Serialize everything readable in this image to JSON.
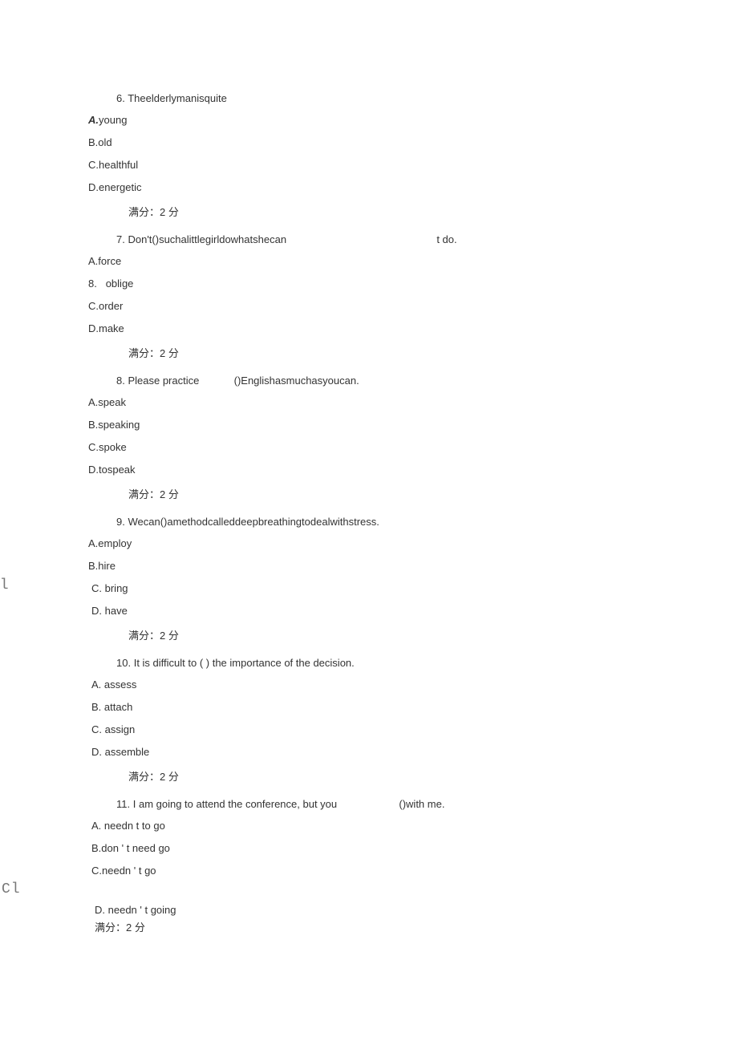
{
  "questions": [
    {
      "num": "6.",
      "text": "Theelderlymanisquite",
      "trail": "",
      "opts": {
        "A": "young",
        "B": "old",
        "C": "healthful",
        "D": "energetic"
      },
      "score": "满分：2 分",
      "bold_a": true
    },
    {
      "num": "7.",
      "text": "Don't()suchalittlegirldowhatshecan",
      "trail": "t do.",
      "opts": {
        "A": "force",
        "B_label": "8.",
        "B": "oblige",
        "C": "order",
        "D": "make"
      },
      "score": "满分：2 分"
    },
    {
      "num": "8.",
      "text_a": "Please practice",
      "text_b": "()Englishasmuchasyoucan.",
      "opts": {
        "A": "speak",
        "B": "speaking",
        "C": "spoke",
        "D": "tospeak"
      },
      "score": "满分：2 分"
    },
    {
      "num": "9.",
      "text": "Wecan()amethodcalleddeepbreathingtodealwithstress.",
      "opts": {
        "A": "employ",
        "B": "hire",
        "C": "bring",
        "D": "have"
      },
      "score": "满分：2 分",
      "margin": "Cl"
    },
    {
      "num": "10.",
      "text": "It is difficult to ( ) the importance of the decision.",
      "opts": {
        "A": "assess",
        "B": "attach",
        "C": "assign",
        "D": "assemble"
      },
      "score": "满分：2 分"
    },
    {
      "num": "11.",
      "text": "I am going to attend the conference, but you",
      "trail": "()with me.",
      "opts": {
        "A": "needn t to go",
        "B": "don ' t need go",
        "C": "needn ' t go",
        "D": "needn ' t going"
      },
      "score": "满分：2 分",
      "margin": "Cl"
    }
  ],
  "labels": {
    "A": "A.",
    "B": "B.",
    "C": "C.",
    "D": "D.",
    "A_sp": "A. ",
    "B_sp": "B.",
    "C_sp": "C. ",
    "D_sp": "D. "
  }
}
